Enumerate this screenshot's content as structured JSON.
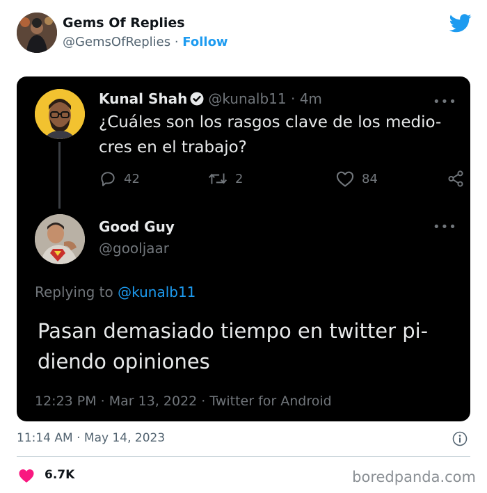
{
  "account": {
    "name": "Gems Of Replies",
    "handle": "@GemsOfReplies",
    "separator": "·",
    "follow_label": "Follow"
  },
  "embedded": {
    "tweet1": {
      "name": "Kunal Shah",
      "handle": "@kunalb11",
      "separator": "·",
      "time": "4m",
      "text": "¿Cuáles son los rasgos clave de los medio-\ncres en el trabajo?",
      "replies": "42",
      "retweets": "2",
      "likes": "84"
    },
    "tweet2": {
      "name": "Good Guy",
      "handle": "@gooljaar",
      "replying_prefix": "Replying to ",
      "replying_to": "@kunalb11",
      "text": "Pasan demasiado tiempo en twitter pi-\ndiendo opiniones",
      "meta": "12:23 PM · Mar 13, 2022 · Twitter for Android"
    },
    "more_label": "•••"
  },
  "post": {
    "timestamp": "11:14 AM · May 14, 2023",
    "likes": "6.7K"
  },
  "watermark": "boredpanda.com",
  "colors": {
    "accent": "#1d9bf0",
    "like": "#f91880",
    "card_bg": "#000000"
  },
  "icons": [
    "twitter-bird-icon",
    "verified-badge-icon",
    "more-icon",
    "reply-icon",
    "retweet-icon",
    "like-icon",
    "share-icon",
    "info-icon",
    "heart-icon"
  ]
}
